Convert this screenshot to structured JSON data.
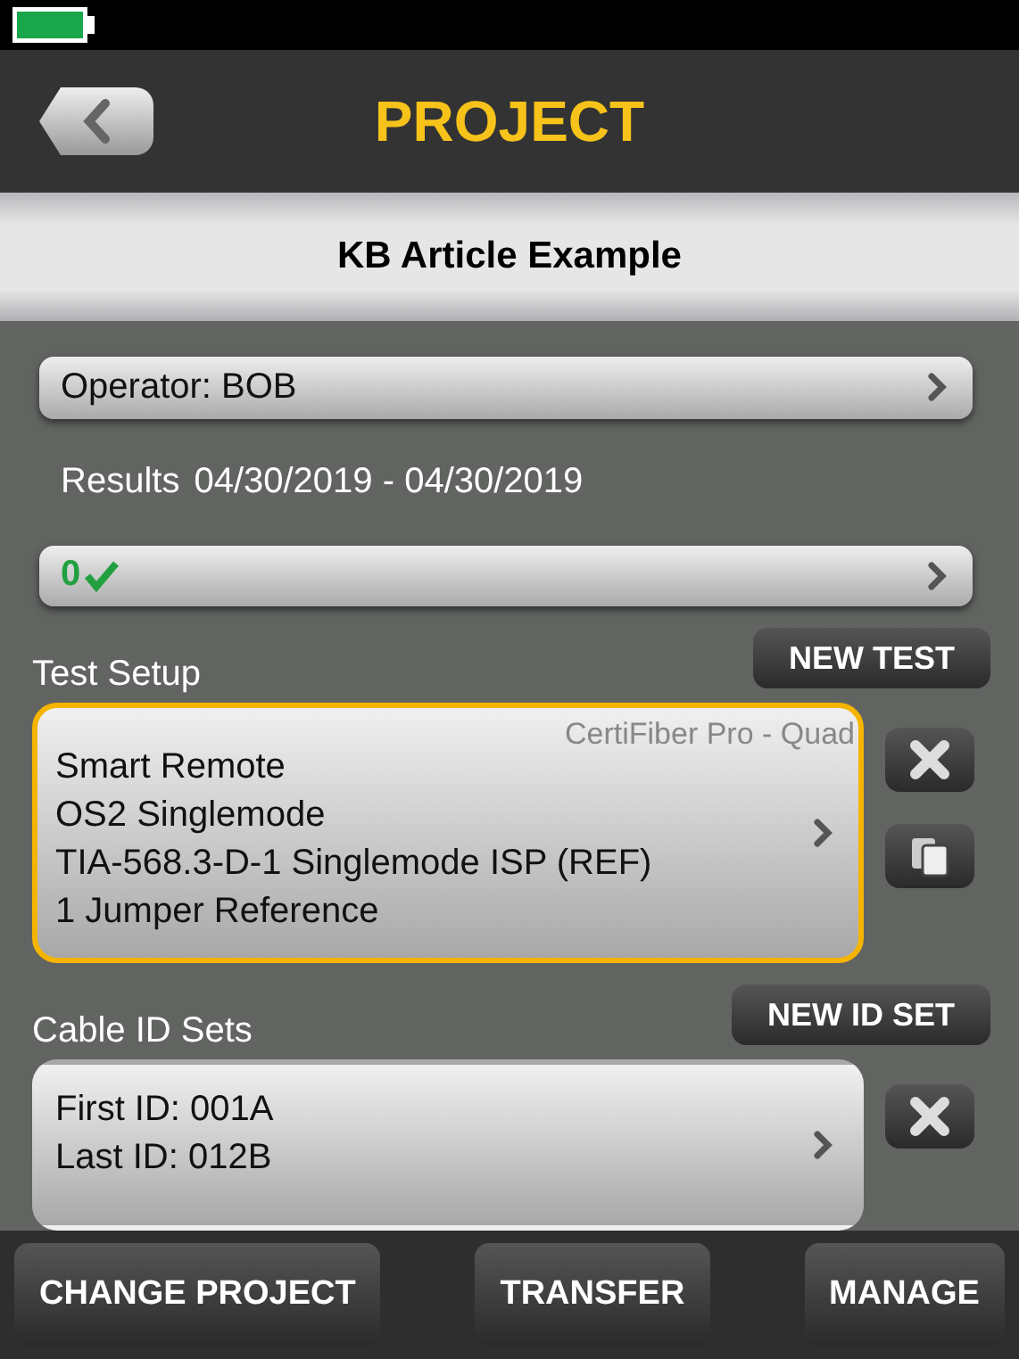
{
  "header": {
    "title": "PROJECT"
  },
  "project_name": "KB Article Example",
  "operator": {
    "label": "Operator: BOB"
  },
  "results": {
    "label": "Results",
    "dates": "04/30/2019 - 04/30/2019",
    "count": "0"
  },
  "test_setup": {
    "label": "Test Setup",
    "new_button": "NEW TEST",
    "card": {
      "selected": true,
      "device": "CertiFiber Pro - Quad",
      "lines": [
        "Smart Remote",
        "OS2 Singlemode",
        "TIA-568.3-D-1 Singlemode ISP (REF)",
        "1 Jumper Reference"
      ]
    }
  },
  "cable_id_sets": {
    "label": "Cable ID Sets",
    "new_button": "NEW ID SET",
    "card": {
      "selected": false,
      "lines": [
        "First ID: 001A",
        "Last ID: 012B"
      ]
    }
  },
  "footer_buttons": [
    "CHANGE PROJECT",
    "TRANSFER",
    "MANAGE"
  ]
}
